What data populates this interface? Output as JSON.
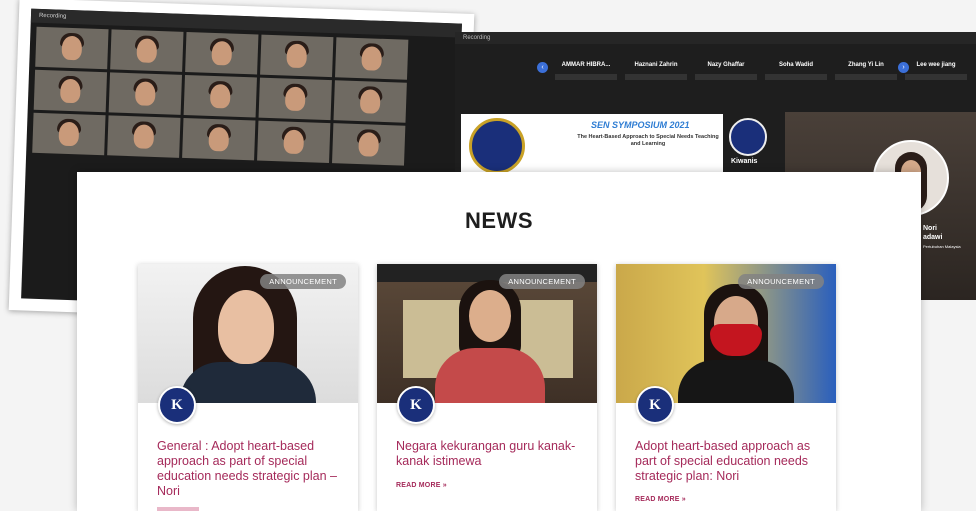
{
  "zoom_left": {
    "window_label": "Recording"
  },
  "zoom_right": {
    "window_label": "Recording",
    "participants": [
      {
        "name": "AMMAR HIBRA..."
      },
      {
        "name": "Haznani Zahrin"
      },
      {
        "name": "Nazy Ghaffar"
      },
      {
        "name": "Soha Wadid"
      },
      {
        "name": "Zhang Yi Lin"
      },
      {
        "name": "Lee wee jiang"
      }
    ],
    "prev_arrow": "‹",
    "next_arrow": "›",
    "slide_title": "SEN SYMPOSIUM 2021",
    "slide_subtitle": "The Heart-Based Approach to Special Needs Teaching and Learning",
    "kiwanis_text": "Kiwanis",
    "speaker_name": "Nori\nadawi",
    "speaker_sub": "Pertubuhan Malaysia"
  },
  "news": {
    "heading": "NEWS",
    "cards": [
      {
        "badge": "ANNOUNCEMENT",
        "logo_letter": "K",
        "title": "General : Adopt heart-based approach as part of special education needs strategic plan – Nori",
        "read_more": ""
      },
      {
        "badge": "ANNOUNCEMENT",
        "logo_letter": "K",
        "title": "Negara kekurangan guru kanak-kanak istimewa",
        "read_more": "READ MORE »"
      },
      {
        "badge": "ANNOUNCEMENT",
        "logo_letter": "K",
        "title": "Adopt heart-based approach as part of special education needs strategic plan: Nori",
        "read_more": "READ MORE »"
      }
    ]
  }
}
